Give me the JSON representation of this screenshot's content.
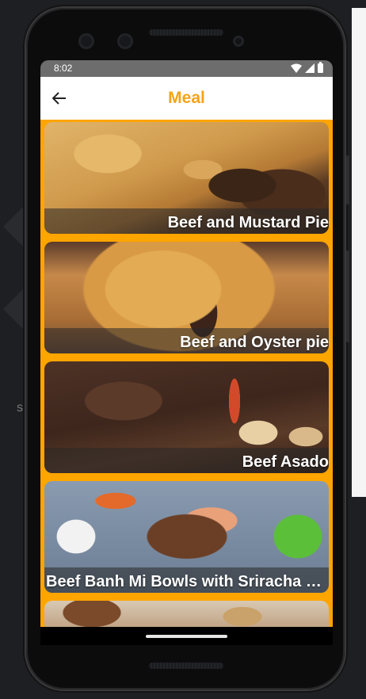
{
  "status_bar": {
    "time": "8:02"
  },
  "app_bar": {
    "title": "Meal",
    "back_icon": "arrow-back-icon",
    "title_color": "#f5a31a"
  },
  "colors": {
    "list_background": "#ffa500",
    "app_bar_background": "#ffffff"
  },
  "meals": [
    {
      "name": "Beef and Mustard Pie"
    },
    {
      "name": "Beef and Oyster pie"
    },
    {
      "name": "Beef Asado"
    },
    {
      "name": "Beef Banh Mi Bowls with Sriracha Mayo, Carrot & Pickled Cucumber"
    },
    {
      "name": ""
    }
  ]
}
